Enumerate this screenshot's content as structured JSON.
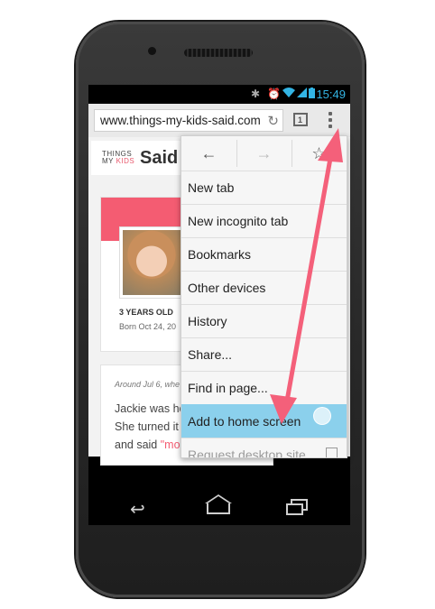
{
  "status_bar": {
    "time": "15:49"
  },
  "browser": {
    "url": "www.things-my-kids-said.com",
    "tab_count": "1"
  },
  "page": {
    "logo": {
      "line1": "THINGS",
      "line2_my": "MY ",
      "line2_kids": "KIDS",
      "said": "Said"
    },
    "profile": {
      "age": "3 YEARS OLD",
      "born": "Born Oct 24, 20"
    },
    "post": {
      "meta": "Around Jul 6, whe",
      "line1": "Jackie was ho",
      "line2": "She turned it",
      "line3_prefix": "and said ",
      "line3_quote": "\"mo"
    }
  },
  "menu": {
    "items": [
      {
        "label": "New tab"
      },
      {
        "label": "New incognito tab"
      },
      {
        "label": "Bookmarks"
      },
      {
        "label": "Other devices"
      },
      {
        "label": "History"
      },
      {
        "label": "Share..."
      },
      {
        "label": "Find in page..."
      },
      {
        "label": "Add to home screen"
      },
      {
        "label": "Request desktop site"
      }
    ]
  },
  "colors": {
    "accent": "#f45c72",
    "highlight": "#8bd0ec",
    "status": "#33b5e5",
    "arrow": "#f4607a"
  }
}
